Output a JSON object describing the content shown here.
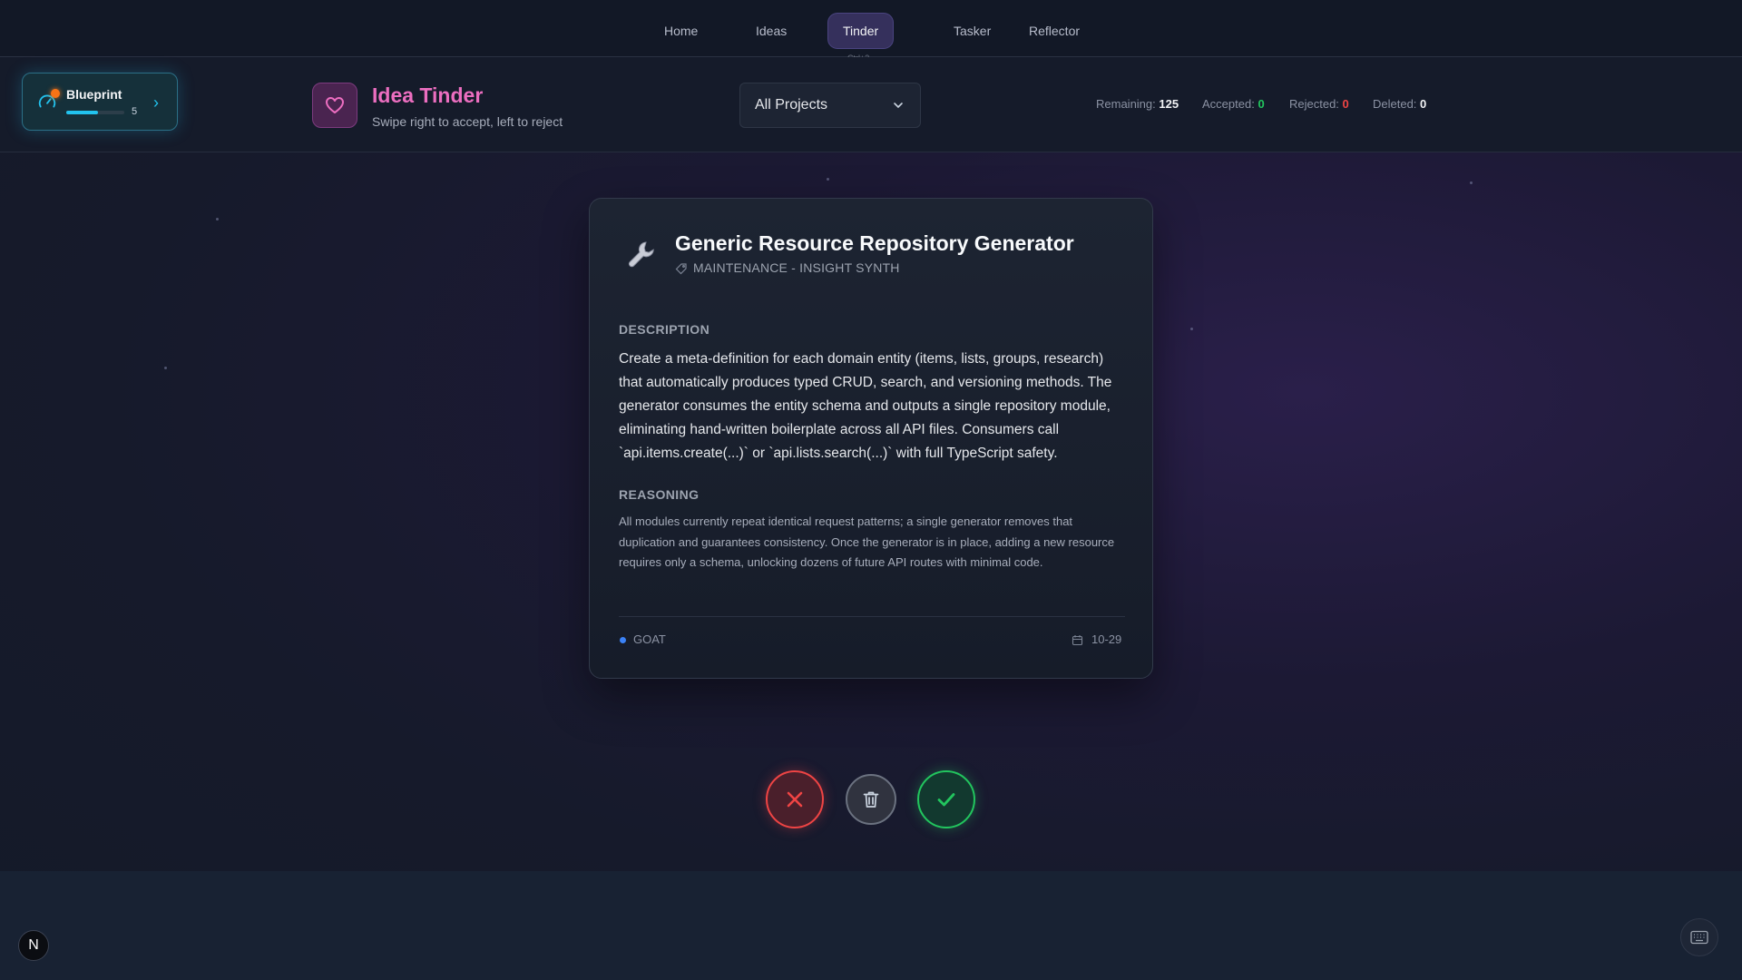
{
  "nav": {
    "items": [
      {
        "label": "Home"
      },
      {
        "label": "Ideas"
      },
      {
        "label": "Tinder"
      },
      {
        "label": "Tasker"
      },
      {
        "label": "Reflector"
      }
    ],
    "active": "Tinder",
    "shortcut_hint": "Ctrl+3"
  },
  "blueprint": {
    "title": "Blueprint",
    "count": "5",
    "progress": 0.55,
    "icon": "gauge-icon"
  },
  "header": {
    "title": "Idea Tinder",
    "subtitle": "Swipe right to accept, left to reject",
    "icon": "heart-icon"
  },
  "project_filter": {
    "selected": "All Projects"
  },
  "stats": {
    "remaining_label": "Remaining:",
    "remaining": "125",
    "accepted_label": "Accepted:",
    "accepted": "0",
    "rejected_label": "Rejected:",
    "rejected": "0",
    "deleted_label": "Deleted:",
    "deleted": "0"
  },
  "card": {
    "icon": "wrench-icon",
    "title": "Generic Resource Repository Generator",
    "category": "MAINTENANCE - INSIGHT SYNTH",
    "description_label": "DESCRIPTION",
    "description": "Create a meta-definition for each domain entity (items, lists, groups, research) that automatically produces typed CRUD, search, and versioning methods. The generator consumes the entity schema and outputs a single repository module, eliminating hand-written boilerplate across all API files. Consumers call `api.items.create(...)` or `api.lists.search(...)` with full TypeScript safety.",
    "reasoning_label": "REASONING",
    "reasoning": "All modules currently repeat identical request patterns; a single generator removes that duplication and guarantees consistency. Once the generator is in place, adding a new resource requires only a schema, unlocking dozens of future API routes with minimal code.",
    "effort": "GOAT",
    "date": "10-29"
  },
  "actions": {
    "reject_icon": "x-icon",
    "delete_icon": "trash-icon",
    "accept_icon": "check-icon"
  },
  "footer": {
    "badge": "N",
    "keyboard_icon": "keyboard-icon"
  },
  "colors": {
    "accent_pink": "#ec6ec0",
    "accepted_green": "#22c55e",
    "rejected_red": "#ef4444",
    "blueprint_cyan": "#22c3ee"
  }
}
